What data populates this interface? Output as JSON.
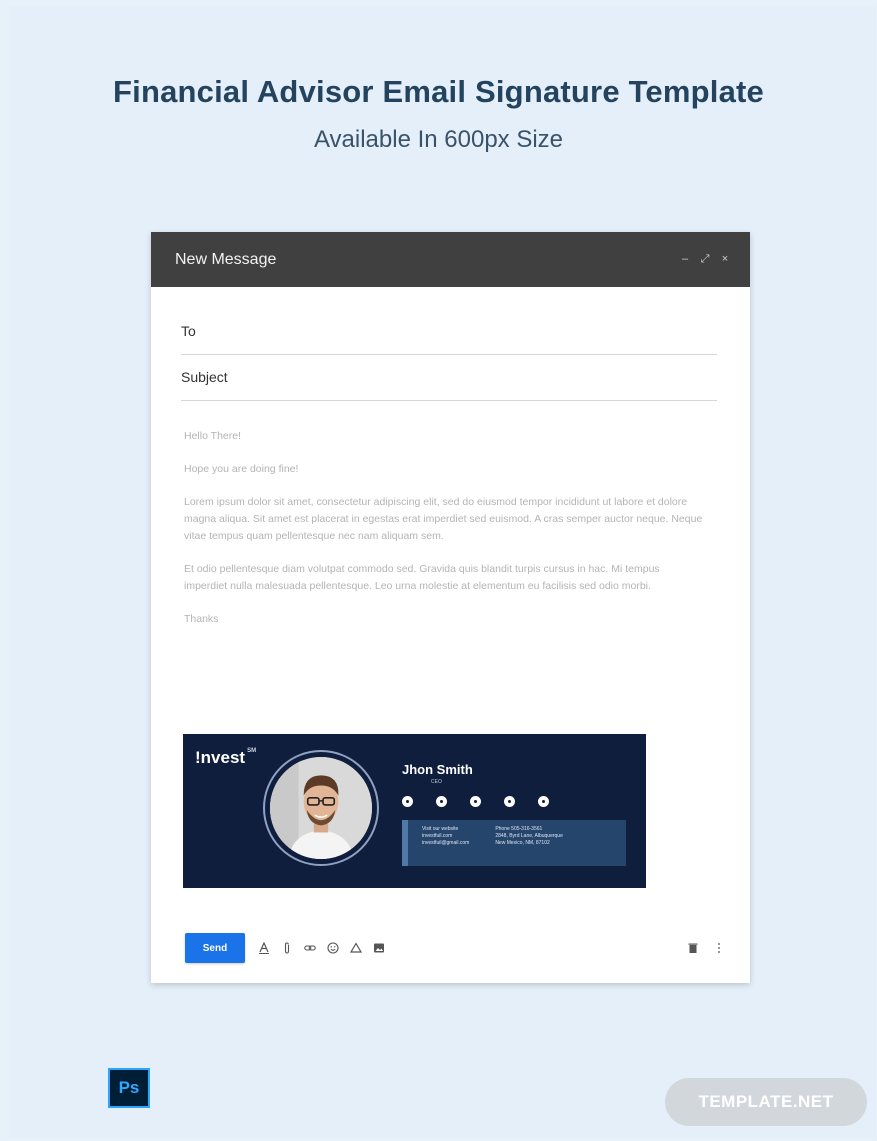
{
  "poster": {
    "title": "Financial Advisor Email Signature Template",
    "subtitle": "Available In 600px Size"
  },
  "compose": {
    "title": "New Message",
    "controls": [
      "–",
      "⤢",
      "×"
    ],
    "to_label": "To",
    "subject_label": "Subject",
    "to_value": "",
    "subject_value": ""
  },
  "body": {
    "greeting": "Hello There!",
    "line2": "Hope you are doing fine!",
    "para1": "Lorem ipsum dolor sit amet, consectetur adipiscing elit, sed do eiusmod tempor incididunt ut labore et dolore magna aliqua. Sit amet est placerat in egestas erat imperdiet sed euismod. A cras semper auctor neque. Neque vitae tempus quam pellentesque nec nam aliquam sem.",
    "para2": " Et odio pellentesque diam volutpat commodo sed. Gravida quis blandit turpis cursus in hac. Mi tempus imperdiet nulla malesuada pellentesque. Leo urna molestie at elementum eu facilisis sed odio morbi.",
    "closing": "Thanks"
  },
  "signature": {
    "brand": "!nvest",
    "brand_mark": "SM",
    "name": "Jhon Smith",
    "role": "CEO",
    "social": [
      "facebook-icon",
      "twitter-icon",
      "linkedin-icon",
      "google-plus-icon",
      "pinterest-icon"
    ],
    "website_label": "Visit our website",
    "website": "investfuil.com",
    "email": "investfuil@gmail.com",
    "phone": "Phone 505-316-3561",
    "address1": "2848, Byrd Lane, Albuquerque",
    "address2": "New Mexico, NM, 87102"
  },
  "toolbar": {
    "send_label": "Send",
    "icons": [
      "format-text-icon",
      "attach-icon",
      "link-icon",
      "emoji-icon",
      "drive-icon",
      "photo-icon"
    ],
    "right_icons": [
      "trash-icon",
      "more-icon"
    ]
  },
  "badges": {
    "ps": "Ps",
    "template": "TEMPLATE.NET"
  },
  "colors": {
    "background": "#e7f1fa",
    "header": "#404040",
    "signature_bg": "#0f1e3c",
    "send": "#1a73e8"
  }
}
